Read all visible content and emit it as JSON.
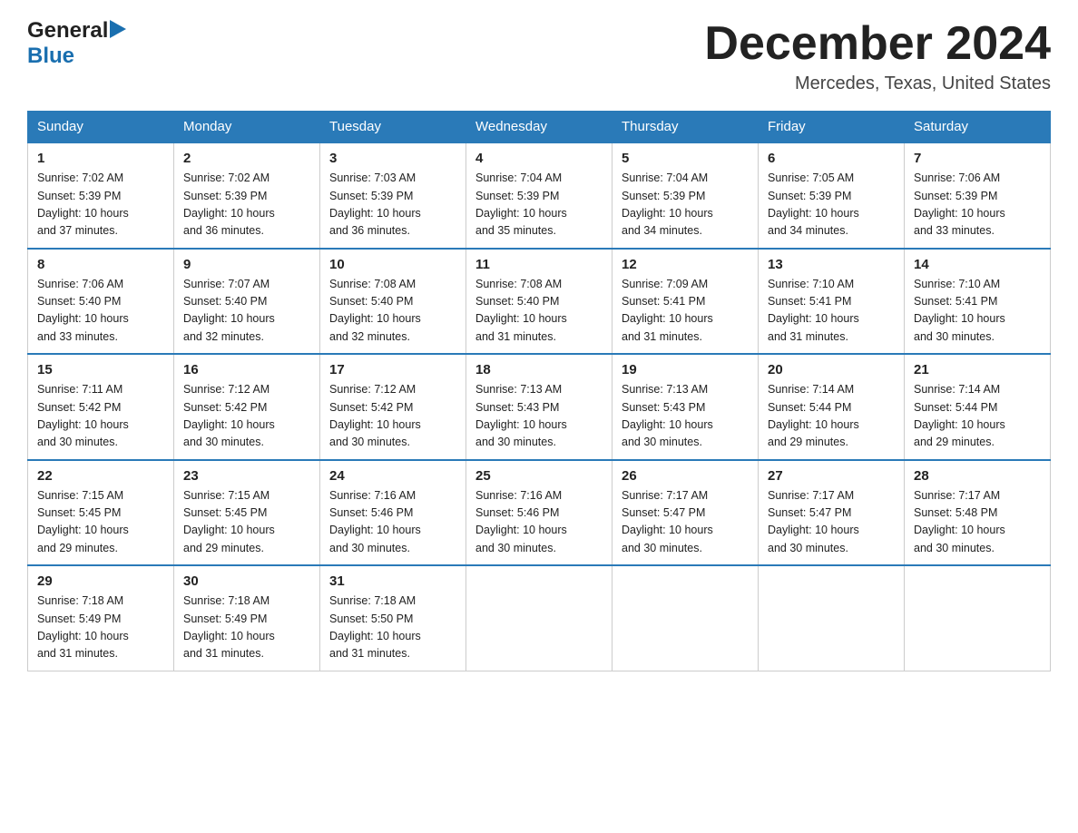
{
  "logo": {
    "general": "General",
    "blue": "Blue",
    "arrow_color": "#1a6faf"
  },
  "header": {
    "month_title": "December 2024",
    "location": "Mercedes, Texas, United States"
  },
  "weekdays": [
    "Sunday",
    "Monday",
    "Tuesday",
    "Wednesday",
    "Thursday",
    "Friday",
    "Saturday"
  ],
  "weeks": [
    [
      {
        "day": "1",
        "sunrise": "7:02 AM",
        "sunset": "5:39 PM",
        "daylight": "10 hours and 37 minutes."
      },
      {
        "day": "2",
        "sunrise": "7:02 AM",
        "sunset": "5:39 PM",
        "daylight": "10 hours and 36 minutes."
      },
      {
        "day": "3",
        "sunrise": "7:03 AM",
        "sunset": "5:39 PM",
        "daylight": "10 hours and 36 minutes."
      },
      {
        "day": "4",
        "sunrise": "7:04 AM",
        "sunset": "5:39 PM",
        "daylight": "10 hours and 35 minutes."
      },
      {
        "day": "5",
        "sunrise": "7:04 AM",
        "sunset": "5:39 PM",
        "daylight": "10 hours and 34 minutes."
      },
      {
        "day": "6",
        "sunrise": "7:05 AM",
        "sunset": "5:39 PM",
        "daylight": "10 hours and 34 minutes."
      },
      {
        "day": "7",
        "sunrise": "7:06 AM",
        "sunset": "5:39 PM",
        "daylight": "10 hours and 33 minutes."
      }
    ],
    [
      {
        "day": "8",
        "sunrise": "7:06 AM",
        "sunset": "5:40 PM",
        "daylight": "10 hours and 33 minutes."
      },
      {
        "day": "9",
        "sunrise": "7:07 AM",
        "sunset": "5:40 PM",
        "daylight": "10 hours and 32 minutes."
      },
      {
        "day": "10",
        "sunrise": "7:08 AM",
        "sunset": "5:40 PM",
        "daylight": "10 hours and 32 minutes."
      },
      {
        "day": "11",
        "sunrise": "7:08 AM",
        "sunset": "5:40 PM",
        "daylight": "10 hours and 31 minutes."
      },
      {
        "day": "12",
        "sunrise": "7:09 AM",
        "sunset": "5:41 PM",
        "daylight": "10 hours and 31 minutes."
      },
      {
        "day": "13",
        "sunrise": "7:10 AM",
        "sunset": "5:41 PM",
        "daylight": "10 hours and 31 minutes."
      },
      {
        "day": "14",
        "sunrise": "7:10 AM",
        "sunset": "5:41 PM",
        "daylight": "10 hours and 30 minutes."
      }
    ],
    [
      {
        "day": "15",
        "sunrise": "7:11 AM",
        "sunset": "5:42 PM",
        "daylight": "10 hours and 30 minutes."
      },
      {
        "day": "16",
        "sunrise": "7:12 AM",
        "sunset": "5:42 PM",
        "daylight": "10 hours and 30 minutes."
      },
      {
        "day": "17",
        "sunrise": "7:12 AM",
        "sunset": "5:42 PM",
        "daylight": "10 hours and 30 minutes."
      },
      {
        "day": "18",
        "sunrise": "7:13 AM",
        "sunset": "5:43 PM",
        "daylight": "10 hours and 30 minutes."
      },
      {
        "day": "19",
        "sunrise": "7:13 AM",
        "sunset": "5:43 PM",
        "daylight": "10 hours and 30 minutes."
      },
      {
        "day": "20",
        "sunrise": "7:14 AM",
        "sunset": "5:44 PM",
        "daylight": "10 hours and 29 minutes."
      },
      {
        "day": "21",
        "sunrise": "7:14 AM",
        "sunset": "5:44 PM",
        "daylight": "10 hours and 29 minutes."
      }
    ],
    [
      {
        "day": "22",
        "sunrise": "7:15 AM",
        "sunset": "5:45 PM",
        "daylight": "10 hours and 29 minutes."
      },
      {
        "day": "23",
        "sunrise": "7:15 AM",
        "sunset": "5:45 PM",
        "daylight": "10 hours and 29 minutes."
      },
      {
        "day": "24",
        "sunrise": "7:16 AM",
        "sunset": "5:46 PM",
        "daylight": "10 hours and 30 minutes."
      },
      {
        "day": "25",
        "sunrise": "7:16 AM",
        "sunset": "5:46 PM",
        "daylight": "10 hours and 30 minutes."
      },
      {
        "day": "26",
        "sunrise": "7:17 AM",
        "sunset": "5:47 PM",
        "daylight": "10 hours and 30 minutes."
      },
      {
        "day": "27",
        "sunrise": "7:17 AM",
        "sunset": "5:47 PM",
        "daylight": "10 hours and 30 minutes."
      },
      {
        "day": "28",
        "sunrise": "7:17 AM",
        "sunset": "5:48 PM",
        "daylight": "10 hours and 30 minutes."
      }
    ],
    [
      {
        "day": "29",
        "sunrise": "7:18 AM",
        "sunset": "5:49 PM",
        "daylight": "10 hours and 31 minutes."
      },
      {
        "day": "30",
        "sunrise": "7:18 AM",
        "sunset": "5:49 PM",
        "daylight": "10 hours and 31 minutes."
      },
      {
        "day": "31",
        "sunrise": "7:18 AM",
        "sunset": "5:50 PM",
        "daylight": "10 hours and 31 minutes."
      },
      null,
      null,
      null,
      null
    ]
  ],
  "labels": {
    "sunrise": "Sunrise:",
    "sunset": "Sunset:",
    "daylight": "Daylight:"
  }
}
